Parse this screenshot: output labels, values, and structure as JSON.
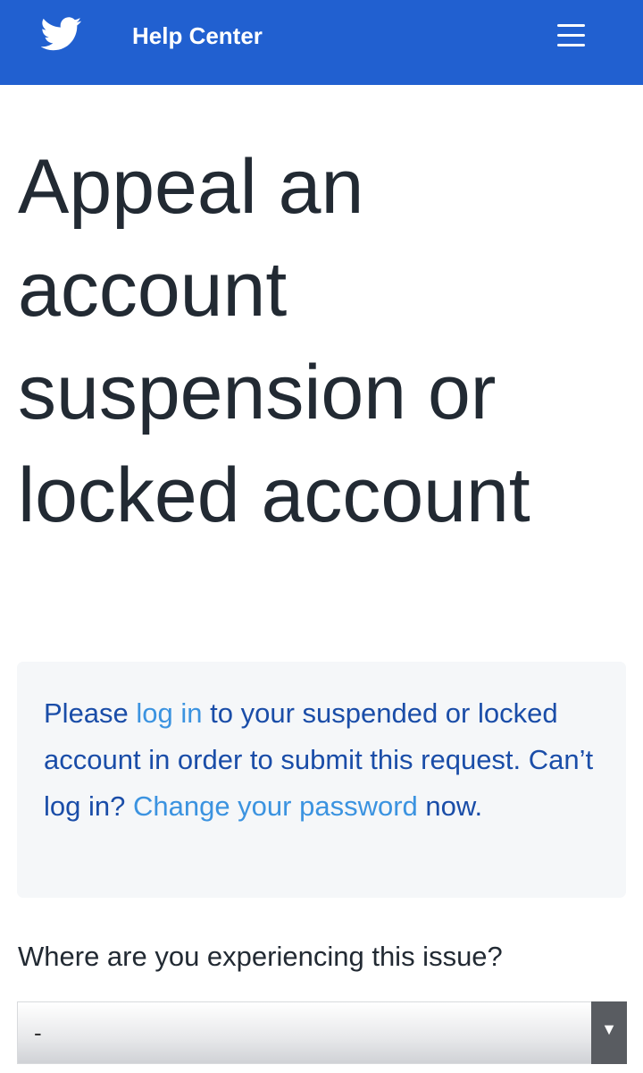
{
  "header": {
    "brand": "Help Center",
    "logo_icon": "twitter-bird-icon",
    "menu_icon": "hamburger-menu-icon",
    "background": "#2160d0"
  },
  "title": {
    "line1": "Appeal an",
    "line2": "account",
    "line3": "suspension or",
    "line4": "locked account"
  },
  "notice": {
    "text_1": "Please ",
    "link_login": "log in",
    "text_2": " to your suspended or locked account in order to submit this request. Can’t log in? ",
    "link_password": "Change your password",
    "text_3": " now."
  },
  "form": {
    "question": "Where are you experiencing this issue?",
    "select_value": "-",
    "select_arrow": "▼"
  }
}
